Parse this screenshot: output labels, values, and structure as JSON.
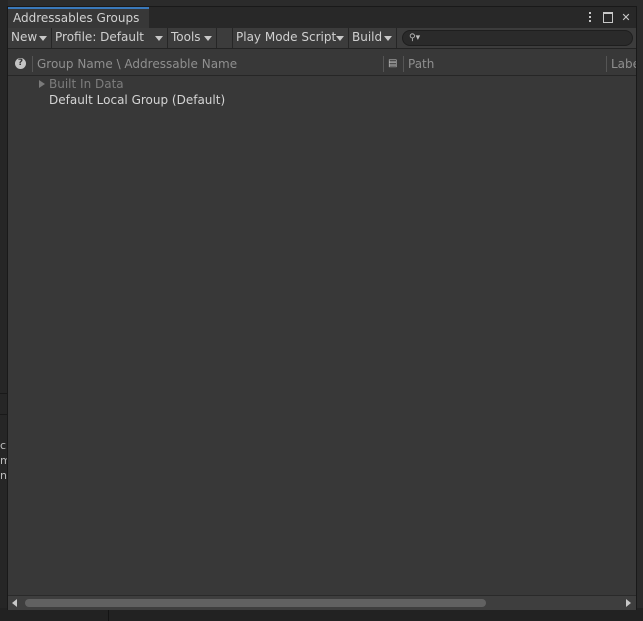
{
  "window": {
    "tab_title": "Addressables Groups"
  },
  "toolbar": {
    "new_label": "New",
    "profile_label": "Profile: Default",
    "tools_label": "Tools",
    "play_mode_label": "Play Mode Script",
    "build_label": "Build",
    "search_value": ""
  },
  "columns": {
    "group_name": "Group Name \\ Addressable Name",
    "path": "Path",
    "labels": "Labels"
  },
  "tree": {
    "items": [
      {
        "label": "Built In Data",
        "expandable": true,
        "disabled": true
      },
      {
        "label": "Default Local Group (Default)",
        "expandable": false,
        "disabled": false
      }
    ]
  },
  "background": {
    "letters": [
      "c",
      "m",
      "na"
    ]
  },
  "colors": {
    "accent": "#3a79bb",
    "panel": "#383838",
    "toolbar": "#3c3c3c"
  },
  "icons": {
    "help": "help-icon",
    "sort": "sort-icon",
    "search": "search-icon",
    "menu": "kebab-menu-icon",
    "maximize": "maximize-icon",
    "close": "close-icon"
  }
}
